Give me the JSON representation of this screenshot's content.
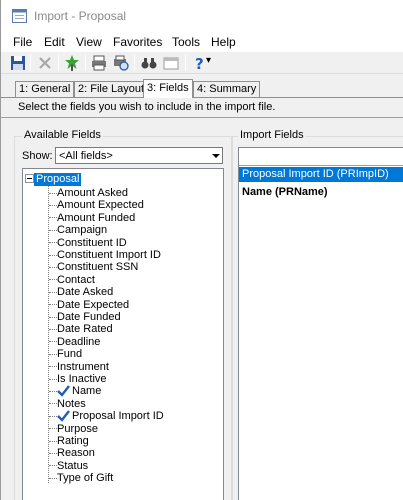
{
  "window": {
    "title": "Import - Proposal"
  },
  "menu": [
    "File",
    "Edit",
    "View",
    "Favorites",
    "Tools",
    "Help"
  ],
  "toolbar": {
    "buttons": [
      "save-icon",
      "delete-icon",
      "run-icon",
      "print-icon",
      "print-preview-icon",
      "find-icon",
      "properties-icon",
      "help-icon"
    ],
    "help_dropdown": "▾"
  },
  "tabs": [
    {
      "label": "1: General"
    },
    {
      "label": "2: File Layout"
    },
    {
      "label": "3: Fields",
      "active": true
    },
    {
      "label": "4: Summary"
    }
  ],
  "instructions": "Select the fields you wish to include in the import file.",
  "available": {
    "label": "Available Fields",
    "show_label": "Show:",
    "show_value": "<All fields>",
    "root": "Proposal",
    "items": [
      {
        "label": "Amount Asked",
        "checked": false
      },
      {
        "label": "Amount Expected",
        "checked": false
      },
      {
        "label": "Amount Funded",
        "checked": false
      },
      {
        "label": "Campaign",
        "checked": false
      },
      {
        "label": "Constituent ID",
        "checked": false
      },
      {
        "label": "Constituent Import ID",
        "checked": false
      },
      {
        "label": "Constituent SSN",
        "checked": false
      },
      {
        "label": "Contact",
        "checked": false
      },
      {
        "label": "Date Asked",
        "checked": false
      },
      {
        "label": "Date Expected",
        "checked": false
      },
      {
        "label": "Date Funded",
        "checked": false
      },
      {
        "label": "Date Rated",
        "checked": false
      },
      {
        "label": "Deadline",
        "checked": false
      },
      {
        "label": "Fund",
        "checked": false
      },
      {
        "label": "Instrument",
        "checked": false
      },
      {
        "label": "Is Inactive",
        "checked": false
      },
      {
        "label": "Name",
        "checked": true
      },
      {
        "label": "Notes",
        "checked": false
      },
      {
        "label": "Proposal Import ID",
        "checked": true
      },
      {
        "label": "Purpose",
        "checked": false
      },
      {
        "label": "Rating",
        "checked": false
      },
      {
        "label": "Reason",
        "checked": false
      },
      {
        "label": "Status",
        "checked": false
      },
      {
        "label": "Type of Gift",
        "checked": false
      }
    ]
  },
  "import": {
    "label": "Import Fields",
    "rows": [
      {
        "label": "Proposal Import ID (PRImpID)",
        "selected": true
      },
      {
        "label": "Name (PRName)",
        "selected": false
      }
    ]
  },
  "colors": {
    "selection": "#0078d7",
    "check": "#1e5fb4"
  }
}
